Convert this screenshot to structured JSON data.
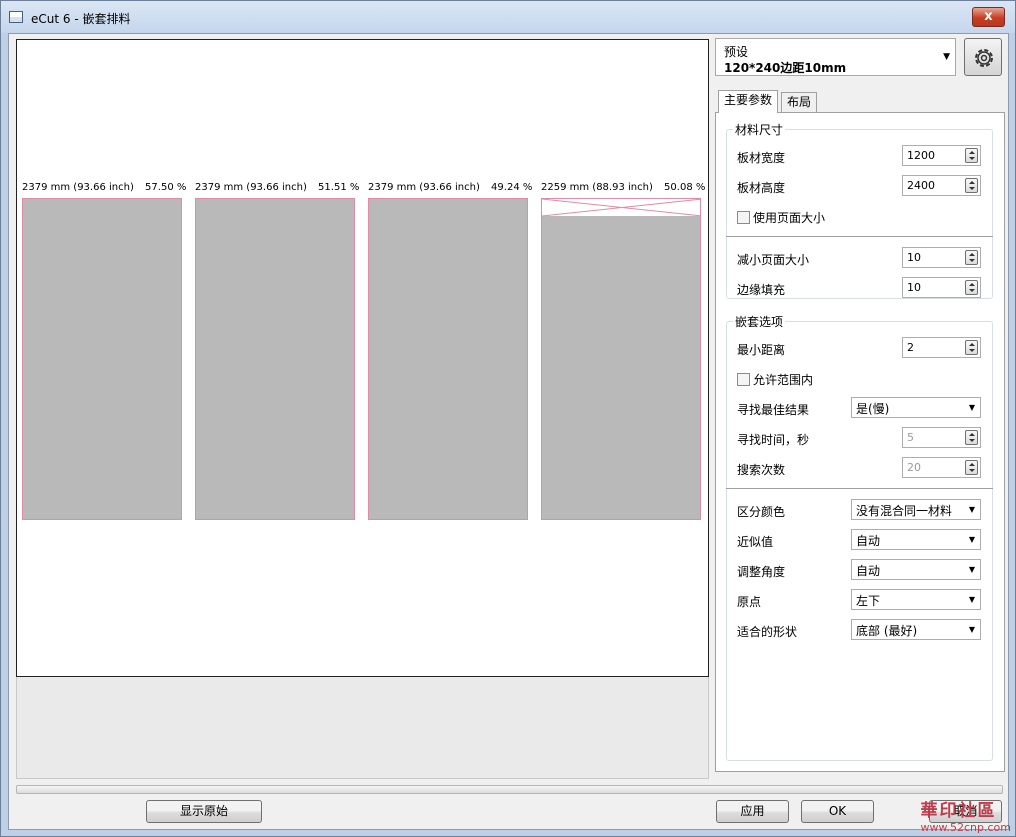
{
  "window": {
    "title": "eCut 6 - 嵌套排料",
    "close_symbol": "x"
  },
  "sheets": [
    {
      "length": "2379 mm (93.66 inch)",
      "percent": "57.50 %"
    },
    {
      "length": "2379 mm (93.66 inch)",
      "percent": "51.51 %"
    },
    {
      "length": "2379 mm (93.66 inch)",
      "percent": "49.24 %"
    },
    {
      "length": "2259 mm (88.93 inch)",
      "percent": "50.08 %"
    }
  ],
  "preset": {
    "label": "预设",
    "value": "120*240边距10mm",
    "arrow": "▼"
  },
  "tabs": {
    "main": "主要参数",
    "layout": "布局"
  },
  "material": {
    "title": "材料尺寸",
    "width_label": "板材宽度",
    "width_value": "1200",
    "height_label": "板材高度",
    "height_value": "2400",
    "use_page_size": "使用页面大小",
    "reduce_page_label": "减小页面大小",
    "reduce_page_value": "10",
    "edge_fill_label": "边缘填充",
    "edge_fill_value": "10"
  },
  "nesting": {
    "title": "嵌套选项",
    "min_distance_label": "最小距离",
    "min_distance_value": "2",
    "allow_in_range": "允许范围内",
    "best_result_label": "寻找最佳结果",
    "best_result_value": "是(慢)",
    "search_time_label": "寻找时间，秒",
    "search_time_value": "5",
    "search_count_label": "搜索次数",
    "search_count_value": "20"
  },
  "options": {
    "color_label": "区分颜色",
    "color_value": "没有混合同一材料",
    "approx_label": "近似值",
    "approx_value": "自动",
    "angle_label": "调整角度",
    "angle_value": "自动",
    "origin_label": "原点",
    "origin_value": "左下",
    "shape_label": "适合的形状",
    "shape_value": "底部 (最好)"
  },
  "buttons": {
    "show_original": "显示原始",
    "apply": "应用",
    "ok": "OK",
    "cancel": "取消"
  },
  "watermark": {
    "brand": "華印社區",
    "url": "www.52cnp.com"
  }
}
